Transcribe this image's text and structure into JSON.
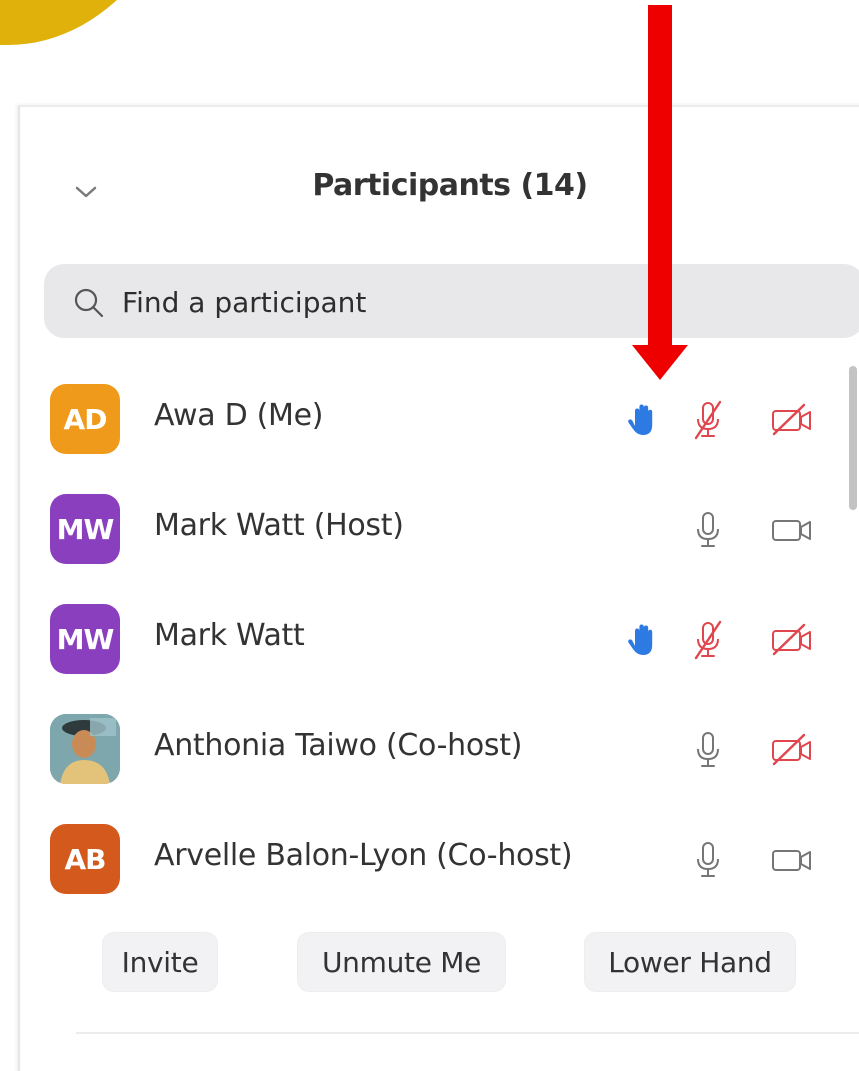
{
  "panel": {
    "title": "Participants (14)",
    "search_placeholder": "Find a participant"
  },
  "participants": [
    {
      "initials": "AD",
      "name": "Awa D (Me)",
      "avatar_color": "#ef9a1b",
      "hand_raised": true,
      "mic": "muted",
      "video": "off"
    },
    {
      "initials": "MW",
      "name": "Mark Watt (Host)",
      "avatar_color": "#8a3fbf",
      "hand_raised": false,
      "mic": "on",
      "video": "on"
    },
    {
      "initials": "MW",
      "name": "Mark Watt",
      "avatar_color": "#8a3fbf",
      "hand_raised": true,
      "mic": "muted",
      "video": "off"
    },
    {
      "initials": "",
      "name": "Anthonia Taiwo (Co-host)",
      "avatar_type": "photo",
      "hand_raised": false,
      "mic": "on",
      "video": "off"
    },
    {
      "initials": "AB",
      "name": "Arvelle Balon-Lyon (Co-host)",
      "avatar_color": "#d4591c",
      "hand_raised": false,
      "mic": "on",
      "video": "on"
    }
  ],
  "footer": {
    "invite_label": "Invite",
    "unmute_label": "Unmute Me",
    "lower_hand_label": "Lower Hand"
  },
  "colors": {
    "hand_icon": "#2d7be2",
    "muted_icon": "#e0464d",
    "normal_icon": "#767676",
    "arrow": "#ee0000",
    "accent_shape": "#e0b10b"
  },
  "icons": {
    "collapse": "chevron-down-icon",
    "search": "search-icon",
    "hand": "raised-hand-icon",
    "mic_on": "microphone-icon",
    "mic_muted": "microphone-muted-icon",
    "video_on": "video-camera-icon",
    "video_off": "video-camera-off-icon"
  }
}
